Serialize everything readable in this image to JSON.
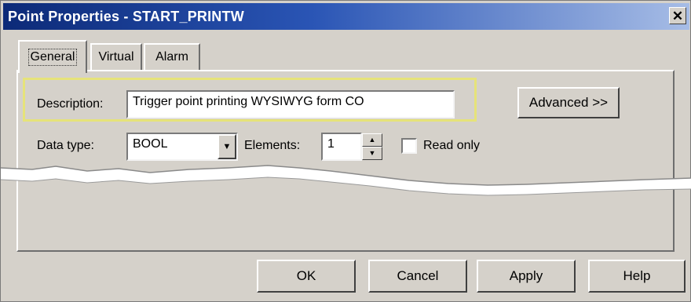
{
  "window": {
    "title": "Point Properties - START_PRINTW",
    "close_glyph": "✕"
  },
  "tabs": [
    {
      "label": "General",
      "active": true
    },
    {
      "label": "Virtual",
      "active": false
    },
    {
      "label": "Alarm",
      "active": false
    }
  ],
  "general": {
    "description_label": "Description:",
    "description_value": "Trigger point printing WYSIWYG form CO",
    "advanced_label": "Advanced >>",
    "data_type_label": "Data type:",
    "data_type_value": "BOOL",
    "elements_label": "Elements:",
    "elements_value": "1",
    "read_only_label": "Read only",
    "read_only_checked": false
  },
  "buttons": {
    "ok": "OK",
    "cancel": "Cancel",
    "apply": "Apply",
    "help": "Help"
  },
  "colors": {
    "title_gradient_start": "#0c2a78",
    "title_gradient_end": "#a7bde6",
    "dialog_face": "#d5d1ca",
    "highlight_border": "#e6e37a"
  },
  "icons": {
    "close": "close-icon",
    "dropdown": "chevron-down-icon",
    "spin_up": "spin-up-icon",
    "spin_down": "spin-down-icon"
  }
}
